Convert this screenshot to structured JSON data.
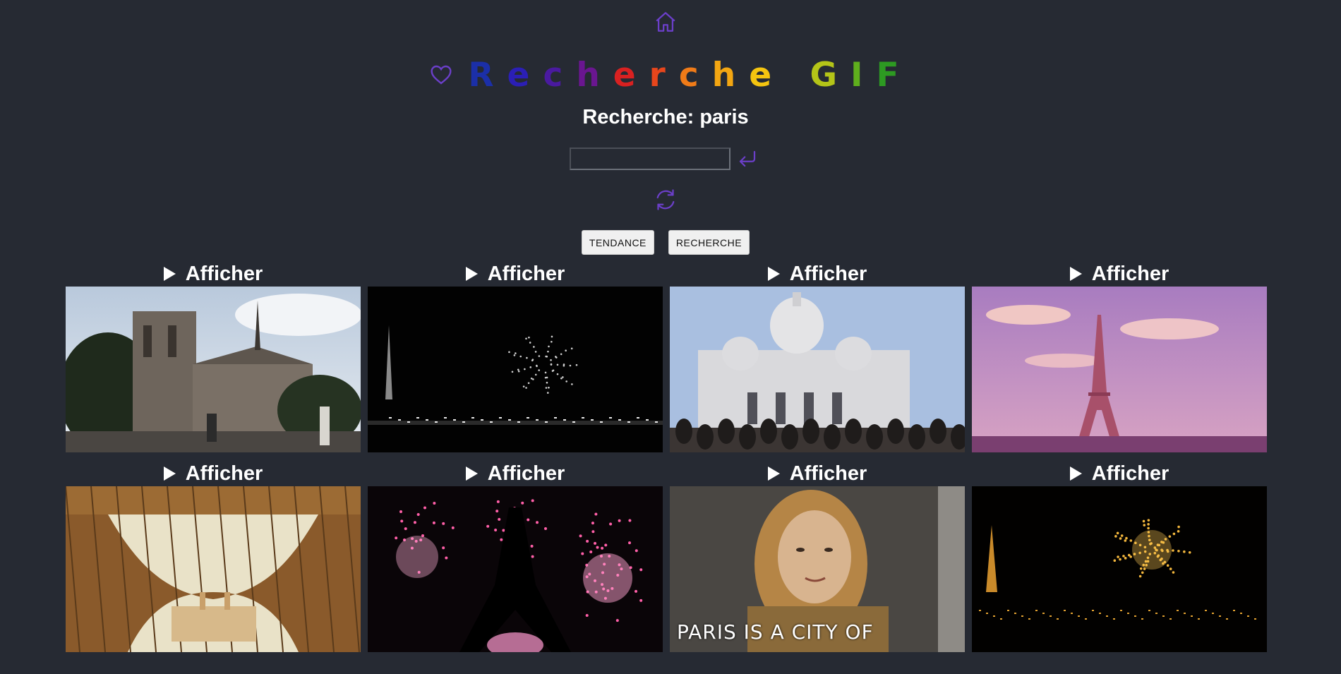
{
  "header": {
    "title_letters": [
      {
        "ch": "R",
        "color": "#1b2fa8"
      },
      {
        "ch": "e",
        "color": "#2b1fb5"
      },
      {
        "ch": "c",
        "color": "#4a1aa0"
      },
      {
        "ch": "h",
        "color": "#6a1690"
      },
      {
        "ch": "e",
        "color": "#d92121"
      },
      {
        "ch": "r",
        "color": "#e8461c"
      },
      {
        "ch": "c",
        "color": "#f07b18"
      },
      {
        "ch": "h",
        "color": "#f3a612"
      },
      {
        "ch": "e",
        "color": "#f4c410"
      },
      {
        "ch": " ",
        "color": "#ffffff"
      },
      {
        "ch": "G",
        "color": "#b4c418"
      },
      {
        "ch": "I",
        "color": "#5fae1d"
      },
      {
        "ch": "F",
        "color": "#2d9a22"
      }
    ],
    "accent_color": "#6b3fc9",
    "icons": {
      "home": "home-icon",
      "favorites": "heart-icon",
      "submit": "enter-arrow-icon",
      "refresh": "refresh-icon"
    }
  },
  "search": {
    "label": "Recherche: paris",
    "value": ""
  },
  "modes": {
    "trending_label": "TENDANCE",
    "search_label": "RECHERCHE"
  },
  "results": [
    {
      "label": "Afficher",
      "scene": "cathedral"
    },
    {
      "label": "Afficher",
      "scene": "night-fireworks"
    },
    {
      "label": "Afficher",
      "scene": "basilica"
    },
    {
      "label": "Afficher",
      "scene": "pink-tower"
    },
    {
      "label": "Afficher",
      "scene": "tower-base"
    },
    {
      "label": "Afficher",
      "scene": "pink-fireworks"
    },
    {
      "label": "Afficher",
      "scene": "woman",
      "caption": "PARIS IS A CITY OF"
    },
    {
      "label": "Afficher",
      "scene": "gold-fireworks"
    }
  ]
}
